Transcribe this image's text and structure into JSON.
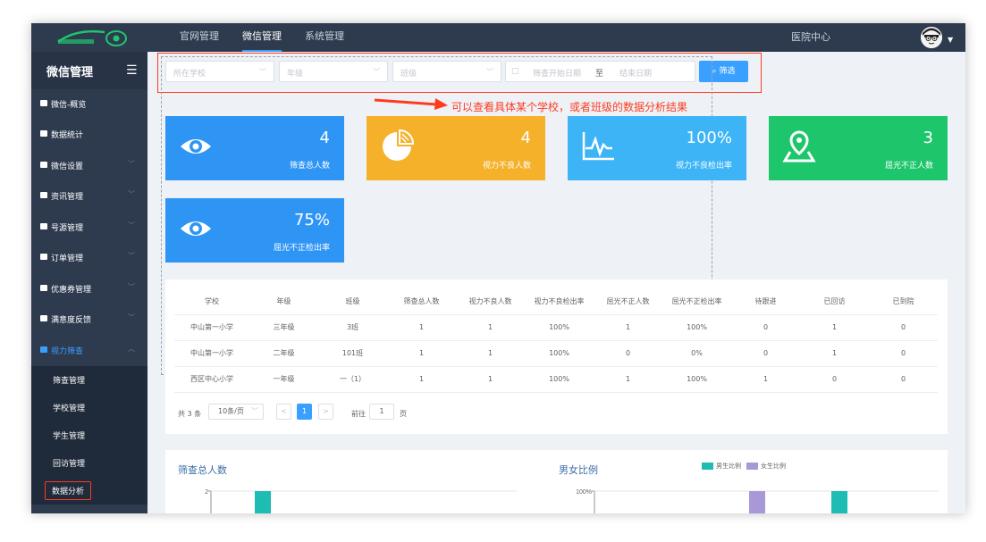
{
  "app": {
    "nav_tabs": [
      {
        "label": "官网管理",
        "active": false
      },
      {
        "label": "微信管理",
        "active": true
      },
      {
        "label": "系统管理",
        "active": false
      }
    ],
    "right_label": "医院中心"
  },
  "sidebar": {
    "title": "微信管理",
    "items": [
      {
        "label": "微信-概览",
        "has_chevron": false
      },
      {
        "label": "数据统计",
        "has_chevron": false
      },
      {
        "label": "微信设置",
        "has_chevron": true
      },
      {
        "label": "资讯管理",
        "has_chevron": true
      },
      {
        "label": "号源管理",
        "has_chevron": true
      },
      {
        "label": "订单管理",
        "has_chevron": true
      },
      {
        "label": "优惠券管理",
        "has_chevron": true
      },
      {
        "label": "满意度反馈",
        "has_chevron": true
      },
      {
        "label": "视力筛查",
        "has_chevron": true,
        "expanded": true
      }
    ],
    "sub_items": [
      {
        "label": "筛查管理"
      },
      {
        "label": "学校管理"
      },
      {
        "label": "学生管理"
      },
      {
        "label": "回访管理"
      },
      {
        "label": "数据分析",
        "current": true
      }
    ]
  },
  "filters": {
    "school_placeholder": "所在学校",
    "grade_placeholder": "年级",
    "class_placeholder": "班级",
    "start_date_placeholder": "筛查开始日期",
    "range_separator": "至",
    "end_date_placeholder": "结束日期",
    "filter_button": "筛选"
  },
  "annotation": "可以查看具体某个学校，或者班级的数据分析结果",
  "stats": [
    {
      "value": "4",
      "label": "筛查总人数",
      "color": "#2f95f5",
      "icon": "eye-icon"
    },
    {
      "value": "4",
      "label": "视力不良人数",
      "color": "#f5b12a",
      "icon": "pie-chart-icon"
    },
    {
      "value": "100%",
      "label": "视力不良检出率",
      "color": "#3db4f6",
      "icon": "pulse-chart-icon"
    },
    {
      "value": "3",
      "label": "屈光不正人数",
      "color": "#1ec66b",
      "icon": "map-pin-icon"
    },
    {
      "value": "75%",
      "label": "屈光不正检出率",
      "color": "#2f95f5",
      "icon": "eye-icon"
    }
  ],
  "table": {
    "headers": [
      "学校",
      "年级",
      "班级",
      "筛查总人数",
      "视力不良人数",
      "视力不良检出率",
      "屈光不正人数",
      "屈光不正检出率",
      "待跟进",
      "已回访",
      "已到院"
    ],
    "rows": [
      [
        "中山第一小学",
        "三年级",
        "3班",
        "1",
        "1",
        "100%",
        "1",
        "100%",
        "0",
        "1",
        "0"
      ],
      [
        "中山第一小学",
        "二年级",
        "101班",
        "1",
        "1",
        "100%",
        "0",
        "0%",
        "0",
        "1",
        "0"
      ],
      [
        "西区中心小学",
        "一年级",
        "一（1）",
        "1",
        "1",
        "100%",
        "1",
        "100%",
        "1",
        "0",
        "0"
      ]
    ]
  },
  "pagination": {
    "total": "共 3 条",
    "page_size": "10条/页",
    "prev": "<",
    "current_page": "1",
    "next": ">",
    "goto_label": "前往",
    "goto_value": "1",
    "goto_suffix": "页"
  },
  "charts": {
    "left_title": "筛查总人数",
    "right_title": "男女比例",
    "legend_male": "男生比例",
    "legend_female": "女生比例",
    "male_color": "#1fbcb4",
    "female_color": "#a998d8"
  },
  "chart_data": [
    {
      "type": "bar",
      "title": "筛查总人数",
      "y_tick_visible": "2",
      "values_visible": [
        2
      ],
      "color": "#1fbcb4"
    },
    {
      "type": "bar",
      "title": "男女比例",
      "y_tick_visible": "100%",
      "series": [
        {
          "name": "男生比例",
          "color": "#1fbcb4"
        },
        {
          "name": "女生比例",
          "color": "#a998d8"
        }
      ]
    }
  ]
}
